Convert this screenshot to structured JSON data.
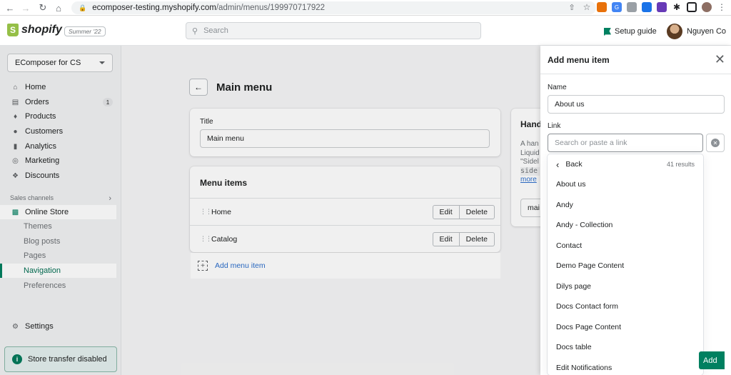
{
  "browser": {
    "url_host": "ecomposer-testing.myshopify.com",
    "url_path": "/admin/menus/199970717922"
  },
  "topbar": {
    "logo_text": "shopify",
    "edition": "Summer '22",
    "search_placeholder": "Search",
    "setup_guide": "Setup guide",
    "user_name": "Nguyen Co"
  },
  "sidebar": {
    "store_name": "EComposer for CS",
    "items": [
      {
        "label": "Home",
        "icon": "home-icon"
      },
      {
        "label": "Orders",
        "icon": "orders-icon",
        "badge": "1"
      },
      {
        "label": "Products",
        "icon": "tag-icon"
      },
      {
        "label": "Customers",
        "icon": "person-icon"
      },
      {
        "label": "Analytics",
        "icon": "bar-chart-icon"
      },
      {
        "label": "Marketing",
        "icon": "target-icon"
      },
      {
        "label": "Discounts",
        "icon": "discount-icon"
      }
    ],
    "sales_channels_label": "Sales channels",
    "online_store": "Online Store",
    "sub_items": [
      "Themes",
      "Blog posts",
      "Pages",
      "Navigation",
      "Preferences"
    ],
    "settings": "Settings",
    "transfer_notice": "Store transfer disabled"
  },
  "main": {
    "page_title": "Main menu",
    "title_label": "Title",
    "title_value": "Main menu",
    "menu_items_heading": "Menu items",
    "menu_items": [
      {
        "label": "Home"
      },
      {
        "label": "Catalog"
      }
    ],
    "edit_label": "Edit",
    "delete_label": "Delete",
    "add_menu_item": "Add menu item",
    "handle_partial": {
      "heading": "Hand",
      "lines": [
        "A han",
        "Liquid",
        "\"Sidel",
        "side",
        "more"
      ],
      "input_value": "mai"
    }
  },
  "panel": {
    "title": "Add menu item",
    "name_label": "Name",
    "name_value": "About us",
    "link_label": "Link",
    "link_placeholder": "Search or paste a link",
    "back_label": "Back",
    "result_count": "41 results",
    "results": [
      "About us",
      "Andy",
      "Andy - Collection",
      "Contact",
      "Demo Page Content",
      "Dilys page",
      "Docs Contact form",
      "Docs Page Content",
      "Docs table",
      "Edit Notifications"
    ],
    "add_button": "Add"
  },
  "colors": {
    "primary": "#008060",
    "link": "#2c6ecb",
    "logo_green": "#95bf47"
  }
}
